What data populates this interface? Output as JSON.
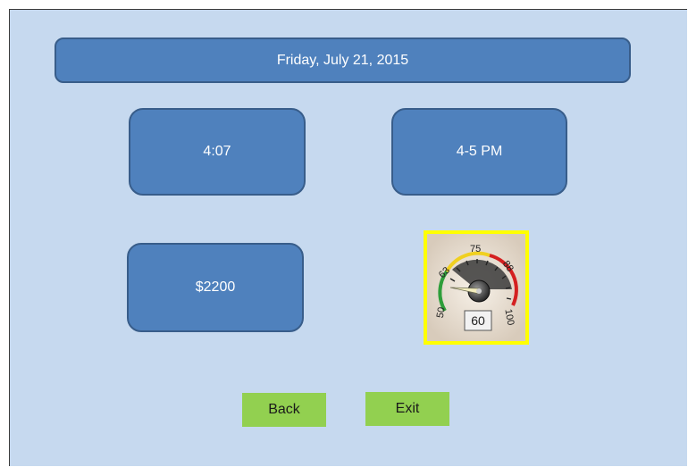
{
  "header": {
    "date": "Friday, July 21, 2015"
  },
  "tiles": {
    "time": "4:07",
    "window": "4-5 PM",
    "price": "$2200"
  },
  "gauge": {
    "value": "60",
    "tick_labels": [
      "50",
      "63",
      "75",
      "88",
      "100"
    ],
    "needle_value": 60,
    "min": 50,
    "max": 100,
    "frame_color": "#ffff00",
    "zone_colors": [
      "#2e9e3a",
      "#f0d020",
      "#d42020"
    ]
  },
  "buttons": {
    "back": "Back",
    "exit": "Exit"
  }
}
